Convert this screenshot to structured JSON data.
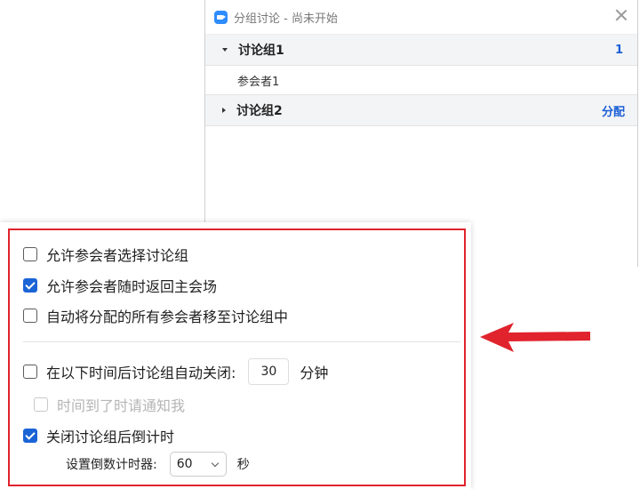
{
  "window": {
    "title": "分组讨论 - 尚未开始",
    "icon": "zoom-camera-icon"
  },
  "groups": [
    {
      "name": "讨论组1",
      "count": "1",
      "expanded": true,
      "participants": [
        "参会者1"
      ]
    },
    {
      "name": "讨论组2",
      "action": "分配",
      "expanded": false
    }
  ],
  "options": {
    "allow_choose": {
      "label": "允许参会者选择讨论组",
      "checked": false
    },
    "allow_return": {
      "label": "允许参会者随时返回主会场",
      "checked": true
    },
    "auto_move": {
      "label": "自动将分配的所有参会者移至讨论组中",
      "checked": false
    },
    "auto_close": {
      "label": "在以下时间后讨论组自动关闭:",
      "value": "30",
      "unit": "分钟",
      "checked": false
    },
    "notify": {
      "label": "时间到了时请通知我",
      "checked": false,
      "disabled": true
    },
    "countdown": {
      "label": "关闭讨论组后倒计时",
      "checked": true
    },
    "timer": {
      "label": "设置倒数计时器:",
      "value": "60",
      "unit": "秒"
    }
  },
  "colors": {
    "accent": "#1a64d6",
    "highlight": "#e0232d"
  }
}
